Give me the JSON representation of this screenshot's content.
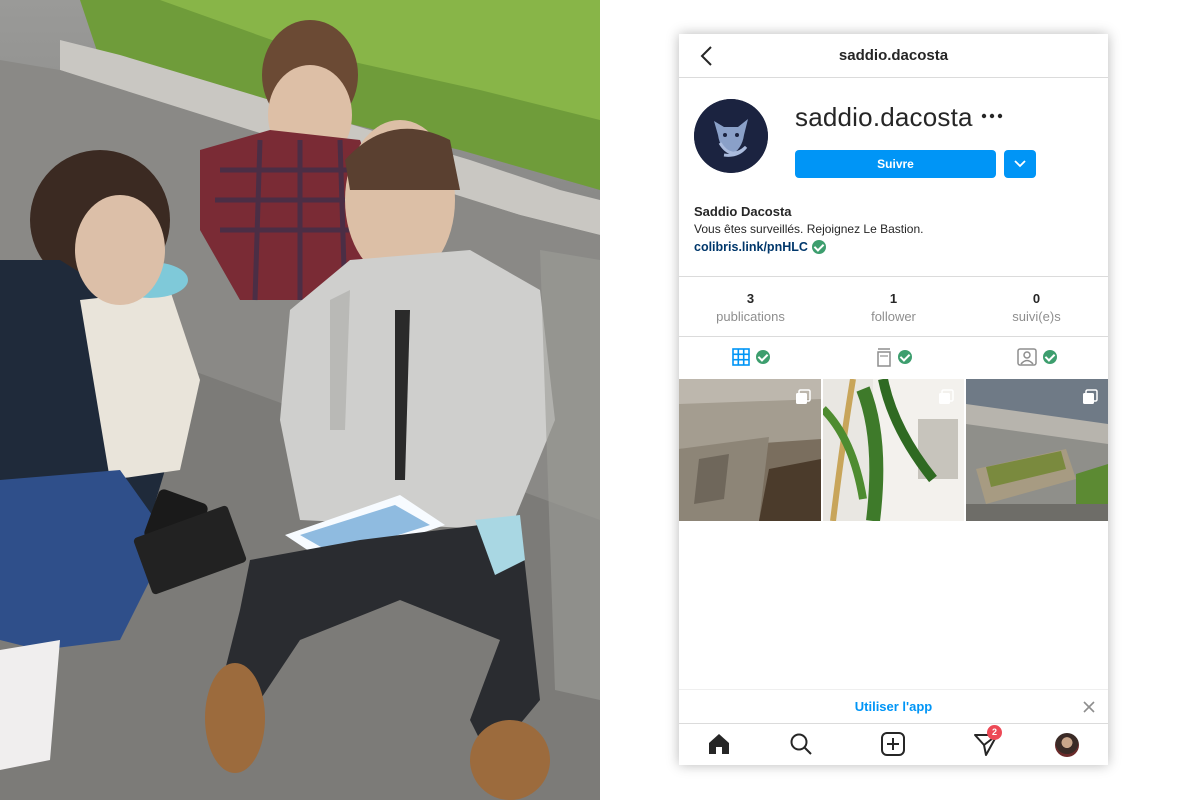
{
  "profile": {
    "header_title": "saddio.dacosta",
    "username": "saddio.dacosta",
    "follow_label": "Suivre",
    "full_name": "Saddio Dacosta",
    "bio": "Vous êtes surveillés. Rejoignez Le Bastion.",
    "link": "colibris.link/pnHLC"
  },
  "stats": [
    {
      "value": "3",
      "label": "publications"
    },
    {
      "value": "1",
      "label": "follower"
    },
    {
      "value": "0",
      "label": "suivi(e)s"
    }
  ],
  "tabs": [
    "grid-icon",
    "igtv-icon",
    "tagged-icon"
  ],
  "posts": [
    "concrete-bench-post",
    "plant-and-wall-post",
    "planter-box-post"
  ],
  "banner": {
    "label": "Utiliser l'app"
  },
  "nav": {
    "notification_count": "2"
  },
  "colors": {
    "accent": "#0095f6",
    "check": "#3d9e6e",
    "badge": "#ed4956"
  }
}
